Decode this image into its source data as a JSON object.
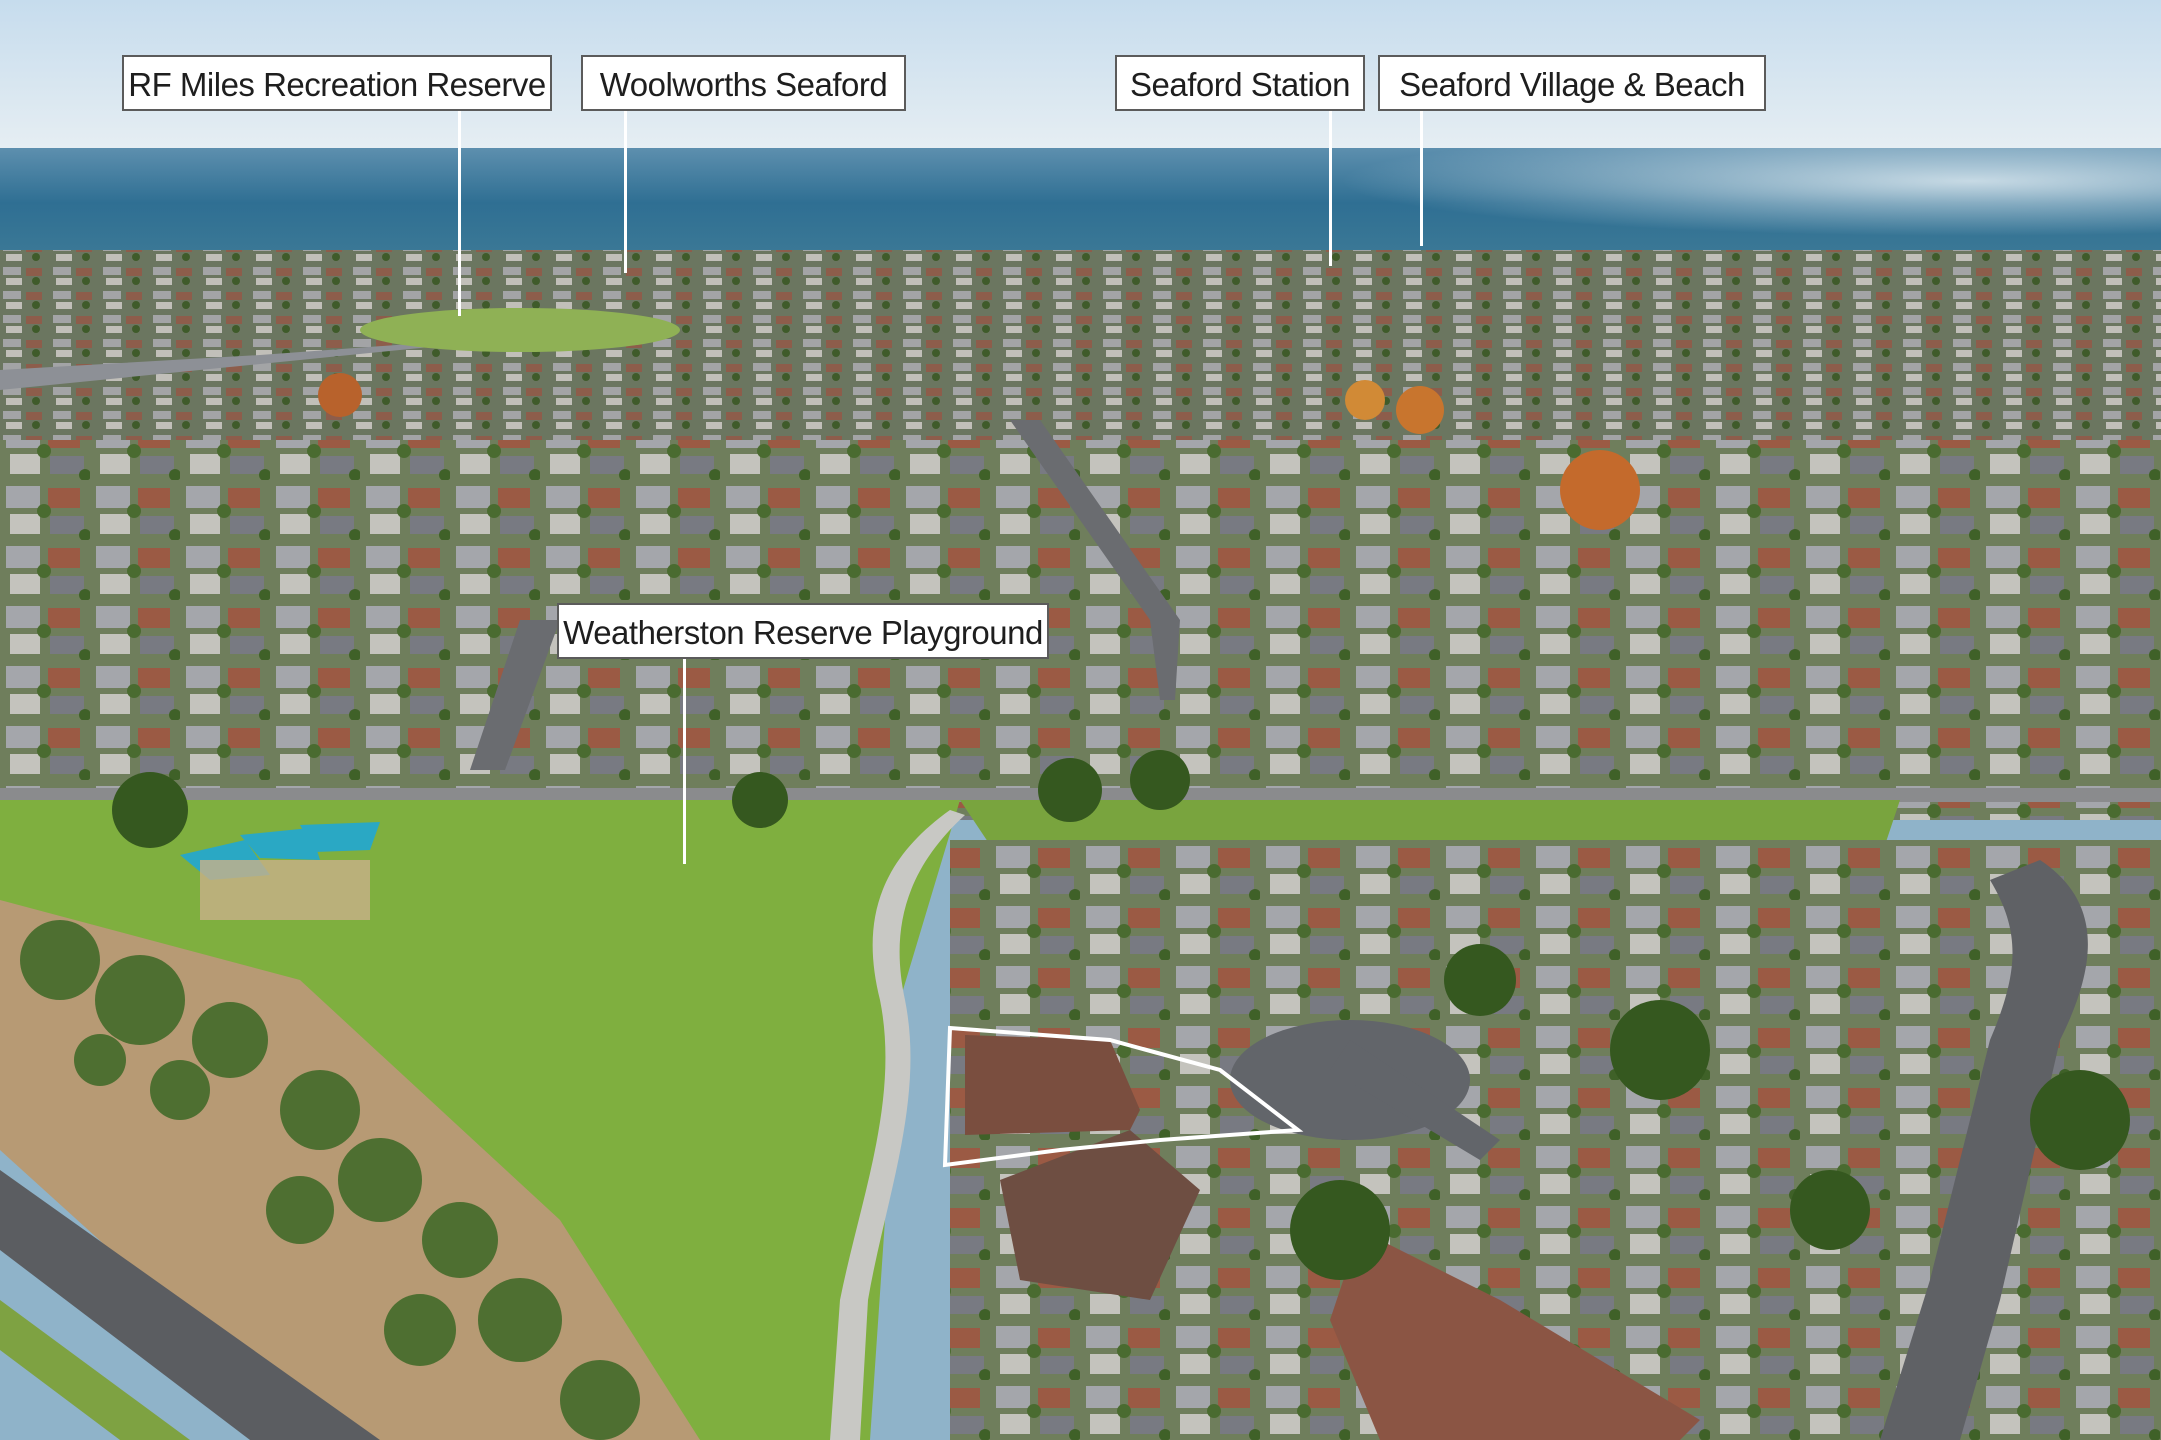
{
  "photo": {
    "description_icon": "aerial-photo",
    "colors": {
      "sky": "#cfe1ee",
      "sea": "#2f6f93",
      "grass": "#7fae3e",
      "roof_red": "#a9513d",
      "roof_grey": "#6d6e74",
      "road": "#5e6064",
      "tree": "#3f6a2a",
      "boundary": "#ffffff"
    }
  },
  "labels": {
    "rf_miles": "RF Miles Recreation Reserve",
    "woolworths": "Woolworths Seaford",
    "station": "Seaford Station",
    "village": "Seaford Village & Beach",
    "playground": "Weatherston Reserve Playground"
  }
}
